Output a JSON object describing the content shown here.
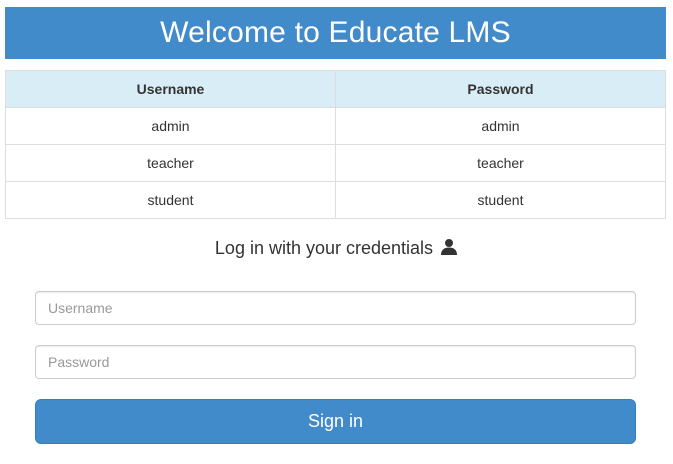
{
  "header": {
    "title": "Welcome to Educate LMS"
  },
  "credentials_table": {
    "columns": [
      "Username",
      "Password"
    ],
    "rows": [
      [
        "admin",
        "admin"
      ],
      [
        "teacher",
        "teacher"
      ],
      [
        "student",
        "student"
      ]
    ]
  },
  "login": {
    "heading": "Log in with your credentials",
    "heading_icon": "user-icon",
    "username_placeholder": "Username",
    "password_placeholder": "Password",
    "username_value": "",
    "password_value": "",
    "submit_label": "Sign in"
  },
  "colors": {
    "primary": "#428bca",
    "table_header_bg": "#d9edf7",
    "border": "#dddddd"
  }
}
